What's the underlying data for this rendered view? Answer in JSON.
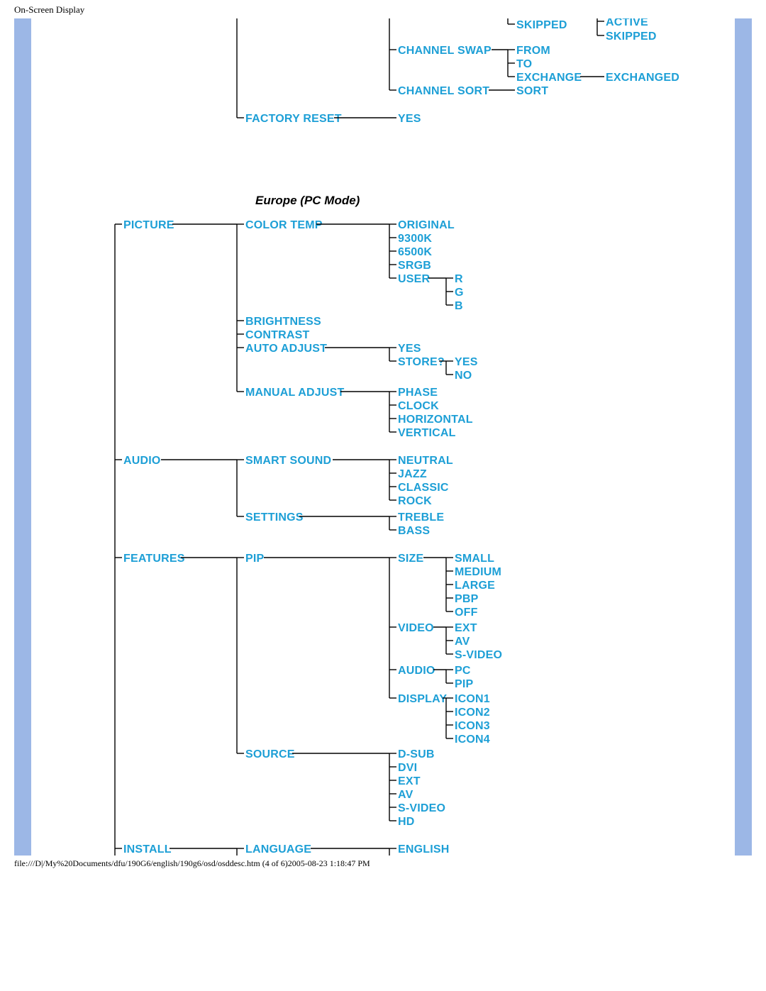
{
  "page_title": "On-Screen Display",
  "footer_text": "file:///D|/My%20Documents/dfu/190G6/english/190g6/osd/osddesc.htm (4 of 6)2005-08-23 1:18:47 PM",
  "top_fragment": {
    "skipped1": "SKIPPED",
    "active": "ACTIVE",
    "skipped2": "SKIPPED",
    "channel_swap": "CHANNEL SWAP",
    "from": "FROM",
    "to": "TO",
    "exchange": "EXCHANGE",
    "exchanged": "EXCHANGED",
    "channel_sort": "CHANNEL SORT",
    "sort": "SORT",
    "factory_reset": "FACTORY RESET",
    "yes": "YES"
  },
  "section_heading": "Europe (PC Mode)",
  "tree": {
    "picture": {
      "label": "PICTURE",
      "color_temp": {
        "label": "COLOR TEMP",
        "original": "ORIGINAL",
        "k9300": "9300K",
        "k6500": "6500K",
        "srgb": "SRGB",
        "user": {
          "label": "USER",
          "r": "R",
          "g": "G",
          "b": "B"
        }
      },
      "brightness": "BRIGHTNESS",
      "contrast": "CONTRAST",
      "auto_adjust": {
        "label": "AUTO ADJUST",
        "yes": "YES",
        "store": {
          "label": "STORE?",
          "yes": "YES",
          "no": "NO"
        }
      },
      "manual_adjust": {
        "label": "MANUAL ADJUST",
        "phase": "PHASE",
        "clock": "CLOCK",
        "horizontal": "HORIZONTAL",
        "vertical": "VERTICAL"
      }
    },
    "audio": {
      "label": "AUDIO",
      "smart_sound": {
        "label": "SMART SOUND",
        "neutral": "NEUTRAL",
        "jazz": "JAZZ",
        "classic": "CLASSIC",
        "rock": "ROCK"
      },
      "settings": {
        "label": "SETTINGS",
        "treble": "TREBLE",
        "bass": "BASS"
      }
    },
    "features": {
      "label": "FEATURES",
      "pip": {
        "label": "PIP",
        "size": {
          "label": "SIZE",
          "small": "SMALL",
          "medium": "MEDIUM",
          "large": "LARGE",
          "pbp": "PBP",
          "off": "OFF"
        },
        "video": {
          "label": "VIDEO",
          "ext": "EXT",
          "av": "AV",
          "svideo": "S-VIDEO"
        },
        "audio": {
          "label": "AUDIO",
          "pc": "PC",
          "pip": "PIP"
        },
        "display": {
          "label": "DISPLAY",
          "icon1": "ICON1",
          "icon2": "ICON2",
          "icon3": "ICON3",
          "icon4": "ICON4"
        }
      },
      "source": {
        "label": "SOURCE",
        "dsub": "D-SUB",
        "dvi": "DVI",
        "ext": "EXT",
        "av": "AV",
        "svideo": "S-VIDEO",
        "hd": "HD"
      }
    },
    "install": {
      "label": "INSTALL",
      "language": {
        "label": "LANGUAGE",
        "english": "ENGLISH"
      }
    }
  }
}
